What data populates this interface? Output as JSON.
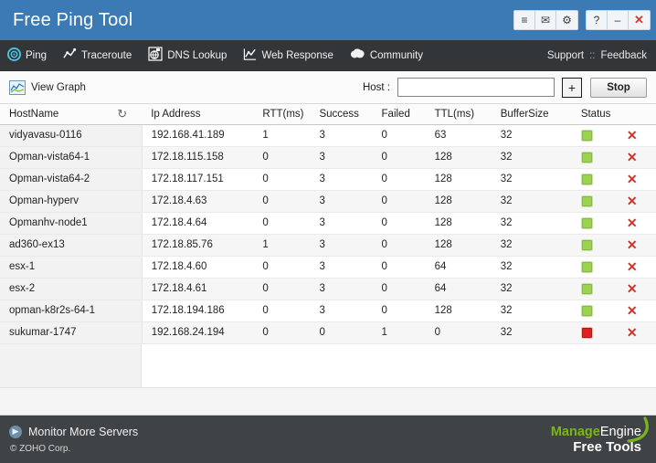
{
  "titlebar": {
    "app_title": "Free Ping Tool",
    "buttons": [
      {
        "name": "menu-icon",
        "label": "≡"
      },
      {
        "name": "mail-icon",
        "label": "✉"
      },
      {
        "name": "gear-icon",
        "label": "⚙"
      }
    ],
    "window_buttons": [
      {
        "name": "help-button",
        "label": "?"
      },
      {
        "name": "minimize-button",
        "label": "–"
      },
      {
        "name": "close-button",
        "label": "✕"
      }
    ],
    "bg_color": "#3b7ab5"
  },
  "nav": {
    "items": [
      {
        "label": "Ping",
        "icon": "target-icon",
        "active": true
      },
      {
        "label": "Traceroute",
        "icon": "route-line-icon",
        "active": false
      },
      {
        "label": "DNS Lookup",
        "icon": "globe-icon",
        "active": false
      },
      {
        "label": "Web Response",
        "icon": "chart-line-icon",
        "active": false
      },
      {
        "label": "Community",
        "icon": "cloud-icon",
        "active": false
      }
    ],
    "support_label": "Support",
    "separator": "::",
    "feedback_label": "Feedback",
    "bg_color": "#333639"
  },
  "toolbar": {
    "view_graph_label": "View Graph",
    "view_graph_icon": "graph-thumbnail-icon",
    "host_label": "Host :",
    "host_value": "",
    "host_placeholder": "",
    "add_label": "+",
    "stop_label": "Stop"
  },
  "table": {
    "columns": [
      "HostName",
      "Ip Address",
      "RTT(ms)",
      "Success",
      "Failed",
      "TTL(ms)",
      "BufferSize",
      "Status",
      ""
    ],
    "refresh_icon": "↻",
    "rows": [
      {
        "hostname": "vidyavasu-0116",
        "ip": "192.168.41.189",
        "rtt": "1",
        "success": "3",
        "failed": "0",
        "ttl": "63",
        "buffer": "32",
        "status": "green",
        "delete": "✕"
      },
      {
        "hostname": "Opman-vista64-1",
        "ip": "172.18.115.158",
        "rtt": "0",
        "success": "3",
        "failed": "0",
        "ttl": "128",
        "buffer": "32",
        "status": "green",
        "delete": "✕"
      },
      {
        "hostname": "Opman-vista64-2",
        "ip": "172.18.117.151",
        "rtt": "0",
        "success": "3",
        "failed": "0",
        "ttl": "128",
        "buffer": "32",
        "status": "green",
        "delete": "✕"
      },
      {
        "hostname": "Opman-hyperv",
        "ip": "172.18.4.63",
        "rtt": "0",
        "success": "3",
        "failed": "0",
        "ttl": "128",
        "buffer": "32",
        "status": "green",
        "delete": "✕"
      },
      {
        "hostname": "Opmanhv-node1",
        "ip": "172.18.4.64",
        "rtt": "0",
        "success": "3",
        "failed": "0",
        "ttl": "128",
        "buffer": "32",
        "status": "green",
        "delete": "✕"
      },
      {
        "hostname": "ad360-ex13",
        "ip": "172.18.85.76",
        "rtt": "1",
        "success": "3",
        "failed": "0",
        "ttl": "128",
        "buffer": "32",
        "status": "green",
        "delete": "✕"
      },
      {
        "hostname": "esx-1",
        "ip": "172.18.4.60",
        "rtt": "0",
        "success": "3",
        "failed": "0",
        "ttl": "64",
        "buffer": "32",
        "status": "green",
        "delete": "✕"
      },
      {
        "hostname": "esx-2",
        "ip": "172.18.4.61",
        "rtt": "0",
        "success": "3",
        "failed": "0",
        "ttl": "64",
        "buffer": "32",
        "status": "green",
        "delete": "✕"
      },
      {
        "hostname": "opman-k8r2s-64-1",
        "ip": "172.18.194.186",
        "rtt": "0",
        "success": "3",
        "failed": "0",
        "ttl": "128",
        "buffer": "32",
        "status": "green",
        "delete": "✕"
      },
      {
        "hostname": "sukumar-1747",
        "ip": "192.168.24.194",
        "rtt": "0",
        "success": "0",
        "failed": "1",
        "ttl": "0",
        "buffer": "32",
        "status": "red",
        "delete": "✕"
      }
    ],
    "status_colors": {
      "green": "#9bd34f",
      "red": "#e02020"
    }
  },
  "footer": {
    "monitor_label": "Monitor More Servers",
    "copyright": "© ZOHO Corp.",
    "logo_manage": "Manage",
    "logo_engine": "Engine",
    "logo_tagline": "Free Tools",
    "bg_color": "#3f4346",
    "accent_green": "#7ab51d"
  }
}
